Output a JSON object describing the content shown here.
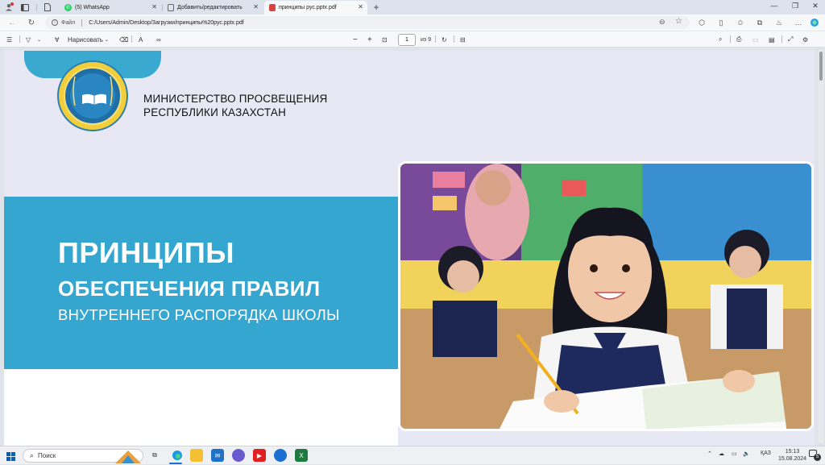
{
  "browser": {
    "tabs": [
      {
        "label": "(5) WhatsApp"
      },
      {
        "label": "Добавить/редактировать"
      },
      {
        "label": "принципы рус.pptx.pdf",
        "active": true
      }
    ],
    "address": {
      "scheme_label": "Файл",
      "url": "C:/Users/Admin/Desktop/Загрузки/принципы%20рус.pptx.pdf"
    }
  },
  "pdf_toolbar": {
    "draw_label": "Нарисовать",
    "page_current": "1",
    "page_total": "из 9"
  },
  "slide": {
    "ministry_line1": "МИНИСТЕРСТВО ПРОСВЕЩЕНИЯ",
    "ministry_line2": "РЕСПУБЛИКИ КАЗАХСТАН",
    "title_line1": "ПРИНЦИПЫ",
    "title_line2": "ОБЕСПЕЧЕНИЯ ПРАВИЛ",
    "title_line3": "ВНУТРЕННЕГО РАСПОРЯДКА ШКОЛЫ"
  },
  "taskbar": {
    "search_placeholder": "Поиск",
    "language": "ҚАЗ",
    "time": "15:13",
    "date": "15.08.2024",
    "notification_count": "5"
  },
  "colors": {
    "accent_blue": "#35a6cf",
    "slide_bg": "#e7e8f4"
  }
}
